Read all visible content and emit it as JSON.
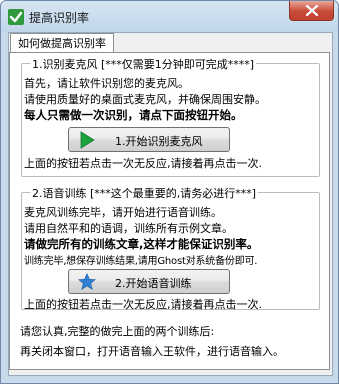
{
  "window": {
    "title": "提高识别率"
  },
  "tab": {
    "label": "如何做提高识别率"
  },
  "section1": {
    "title": "1.识别麦克风 [***仅需要1分钟即可完成****]",
    "lines": [
      "首先，请让软件识别您的麦克风。",
      "请使用质量好的桌面式麦克风，并确保周围安静。"
    ],
    "emphasis": "每人只需做一次识别，请点下面按钮开始。",
    "button_label": "1.开始识别麦克风",
    "note": "上面的按钮若点击一次无反应,请接着再点击一次."
  },
  "section2": {
    "title": "2.语音训练 [***这个最重要的,请务必进行***]",
    "lines": [
      "麦克风训练完毕，请开始进行语音训练。",
      "请用自然平和的语调，训练所有示例文章。"
    ],
    "emphasis": "请做完所有的训练文章,这样才能保证识别率。",
    "line_after": "训练完毕,想保存训练结果,请用Ghost对系统备份即可.",
    "button_label": "2.开始语音训练",
    "note": "上面的按钮若点击一次无反应,请接着再点击一次."
  },
  "footer": {
    "line1": "请您认真,完整的做完上面的两个训练后:",
    "line2": "再关闭本窗口，打开语音输入王软件，进行语音输入。"
  },
  "colors": {
    "play_icon": "#1aa33a",
    "star_icon": "#2f7fd3",
    "close_button": "#c74a36"
  },
  "icons": {
    "app": "app-logo-icon",
    "close": "close-icon",
    "play": "play-icon",
    "star": "star-icon"
  }
}
